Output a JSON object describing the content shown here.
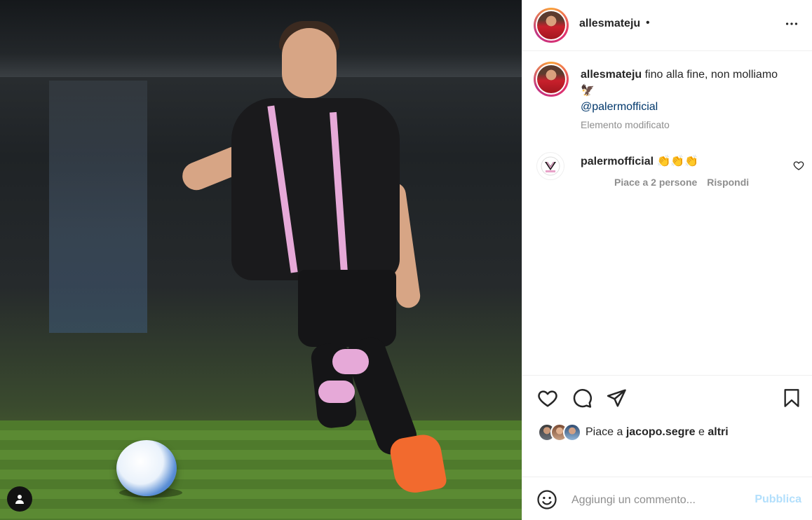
{
  "post": {
    "username": "allesmateju",
    "header_dot": "•",
    "caption_username": "allesmateju",
    "caption_text": "fino alla fine, non molliamo🦅",
    "caption_mention": "@palermofficial",
    "edited_label": "Elemento modificato"
  },
  "comment": {
    "username": "palermofficial",
    "text": "👏👏👏",
    "likes_label": "Piace a 2 persone",
    "reply_label": "Rispondi"
  },
  "likes": {
    "prefix": "Piace a",
    "user": "jacopo.segre",
    "joiner": "e",
    "others": "altri"
  },
  "composer": {
    "placeholder": "Aggiungi un commento...",
    "post_label": "Pubblica"
  },
  "icons": {
    "more": "more-horizontal-icon",
    "like": "heart-icon",
    "comment": "comment-bubble-icon",
    "share": "paper-plane-icon",
    "save": "bookmark-icon",
    "emoji": "smiley-icon",
    "tag": "user-tag-icon"
  },
  "colors": {
    "text": "#262626",
    "secondary": "#8e8e8e",
    "link": "#00376b",
    "post_button_disabled": "#b2dffc",
    "divider": "#efefef"
  }
}
